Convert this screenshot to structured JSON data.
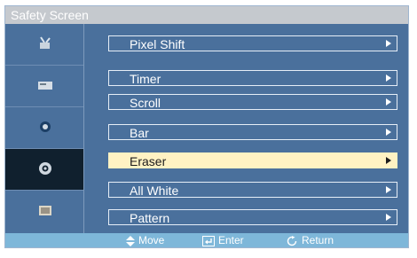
{
  "window": {
    "title": "Safety Screen"
  },
  "sidebar": {
    "items": [
      {
        "icon": "antenna-icon",
        "active": false
      },
      {
        "icon": "display-icon",
        "active": false
      },
      {
        "icon": "circle-icon",
        "active": false
      },
      {
        "icon": "gear-icon",
        "active": true
      },
      {
        "icon": "box-icon",
        "active": false
      }
    ]
  },
  "menu": {
    "items": [
      {
        "label": "Pixel Shift",
        "selected": false
      },
      {
        "label": "Timer",
        "selected": false
      },
      {
        "label": "Scroll",
        "selected": false
      },
      {
        "label": "Bar",
        "selected": false
      },
      {
        "label": "Eraser",
        "selected": true
      },
      {
        "label": "All White",
        "selected": false
      },
      {
        "label": "Pattern",
        "selected": false
      }
    ]
  },
  "hints": {
    "move_label": "Move",
    "enter_label": "Enter",
    "return_label": "Return"
  },
  "colors": {
    "panel": "#4a709c",
    "active_sidebar": "#10202e",
    "selected_item": "#fff2c3",
    "bottom_bar": "#7eb7d9",
    "title_bar": "#c5c9ce"
  }
}
